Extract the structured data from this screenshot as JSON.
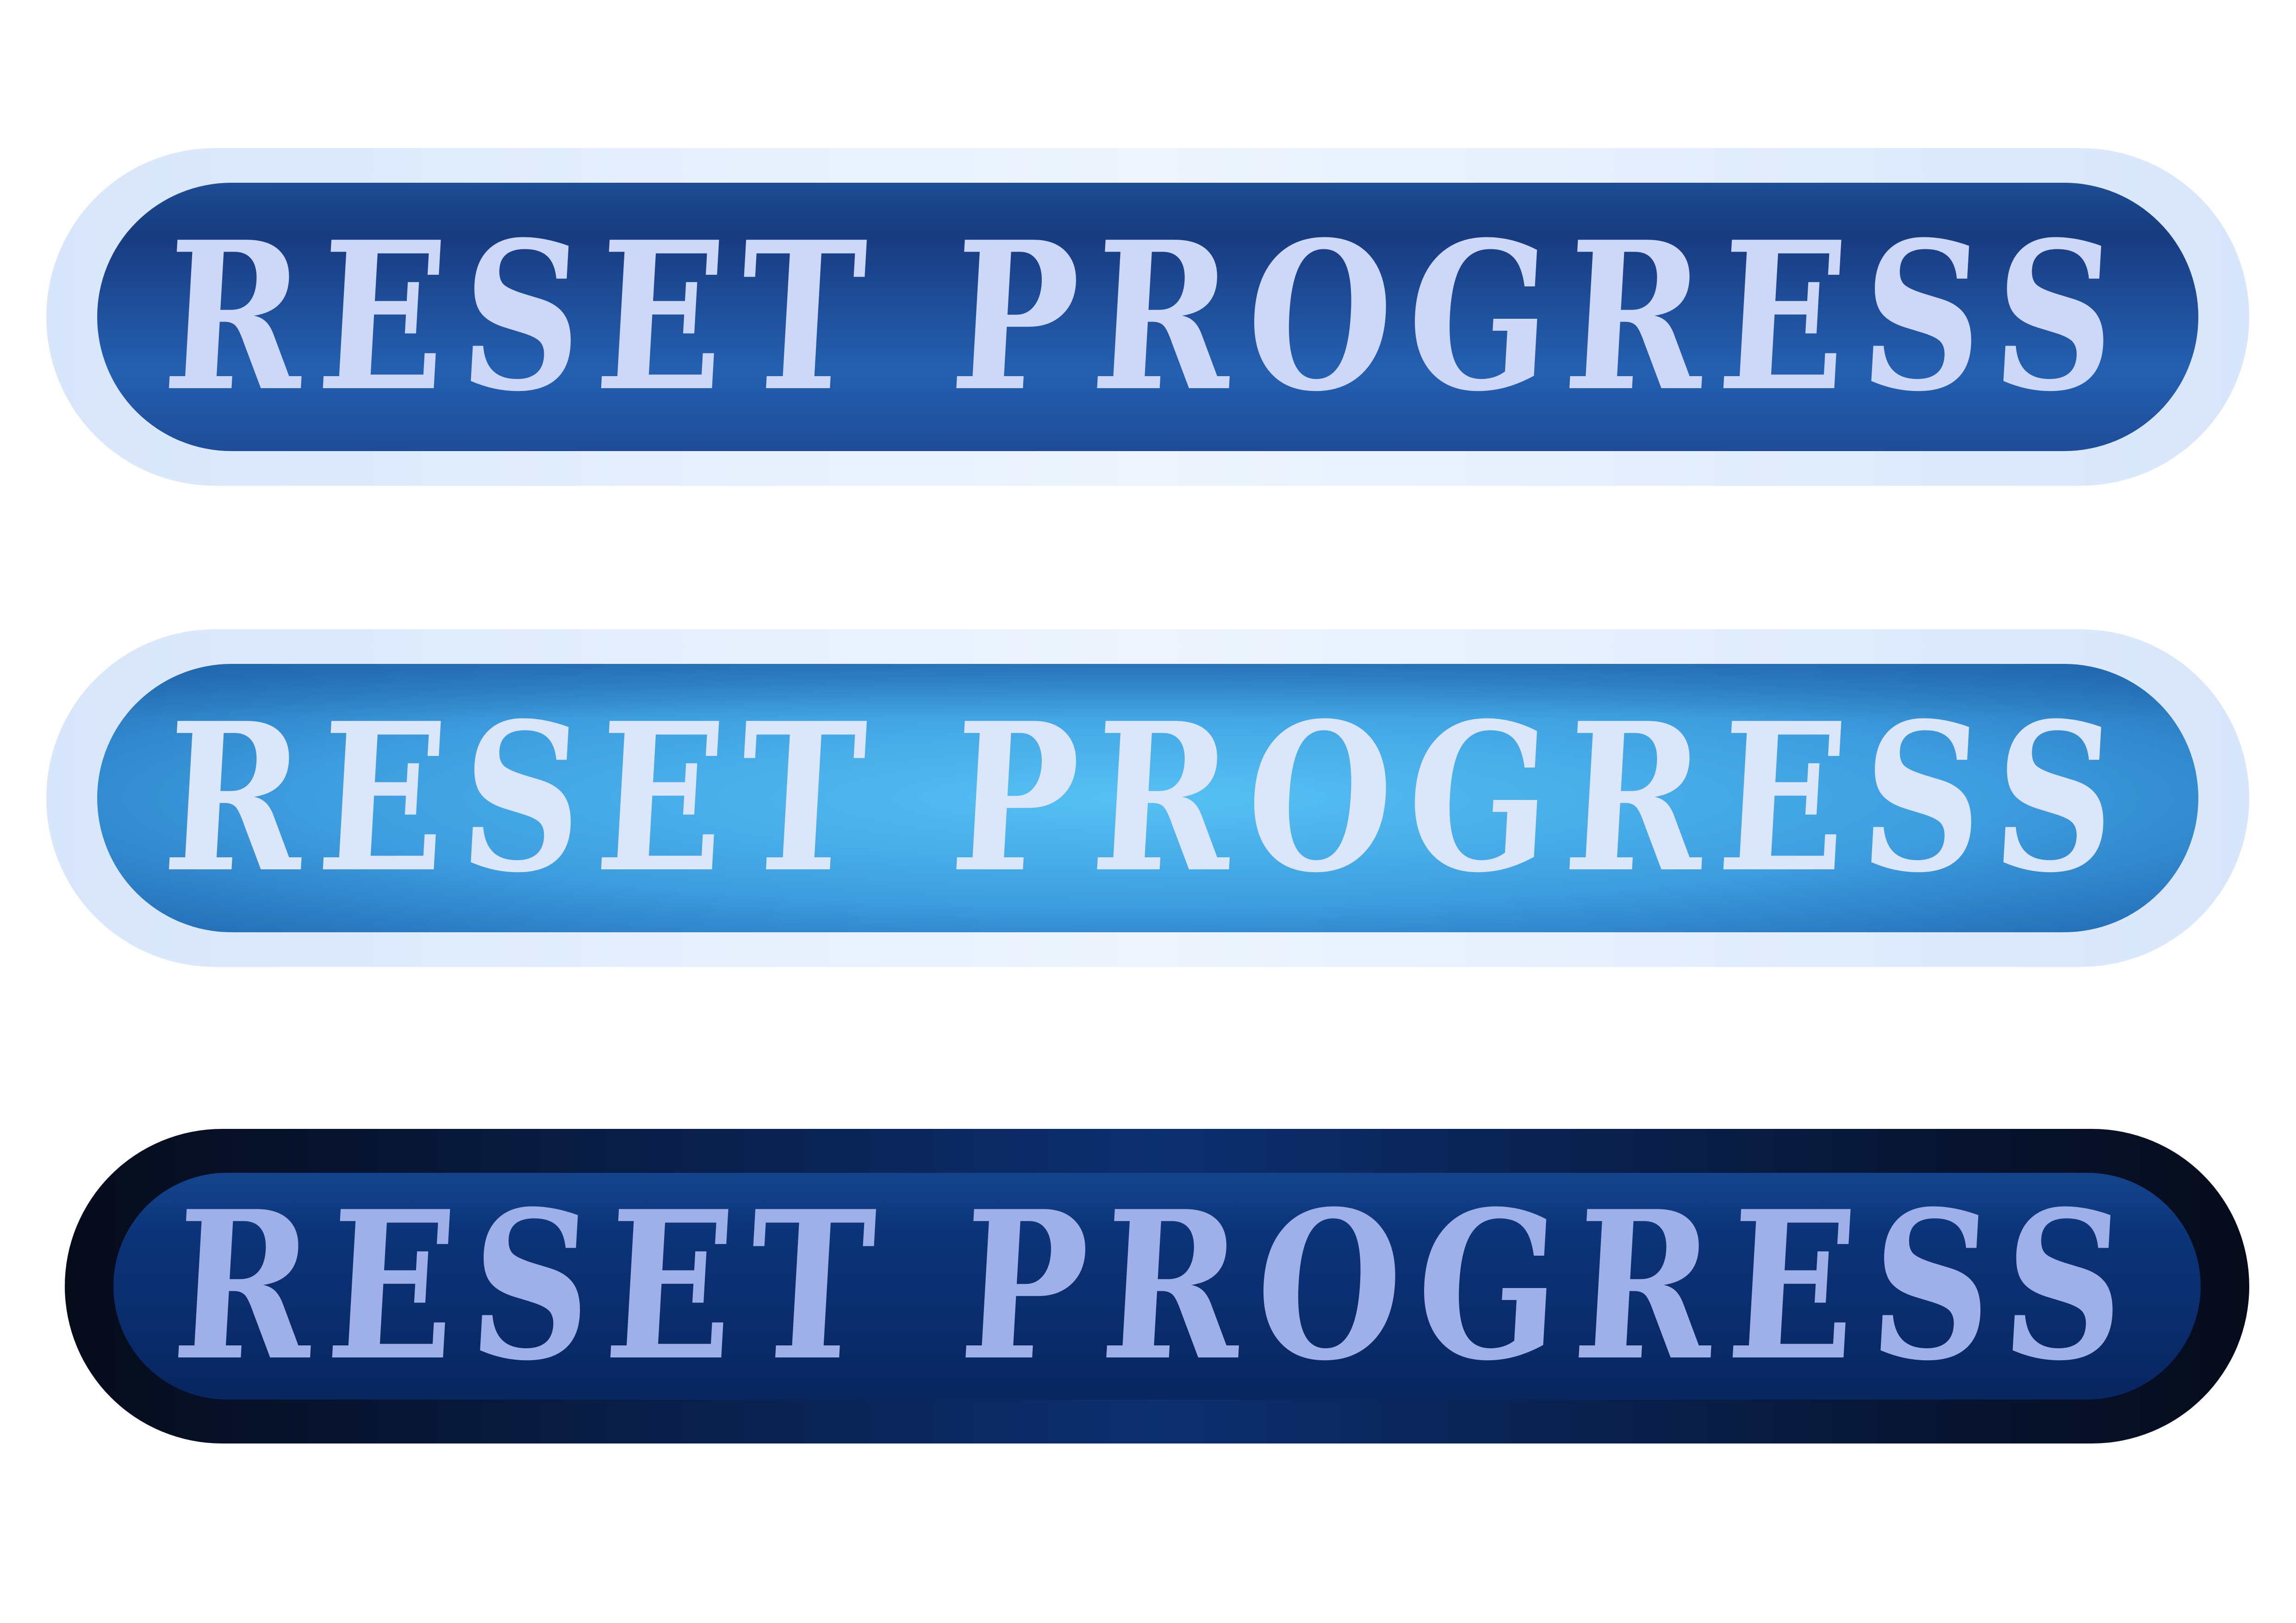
{
  "buttons": {
    "normal": {
      "label": "RESET PROGRESS",
      "state": "normal",
      "face_color": "#1f4a98",
      "text_color": "#cdd8f8"
    },
    "hover": {
      "label": "RESET PROGRESS",
      "state": "hover",
      "face_color": "#4fb4ee",
      "text_color": "#dce6fb"
    },
    "pressed": {
      "label": "RESET PROGRESS",
      "state": "pressed",
      "face_color": "#0b3174",
      "text_color": "#9fb0e8"
    }
  }
}
